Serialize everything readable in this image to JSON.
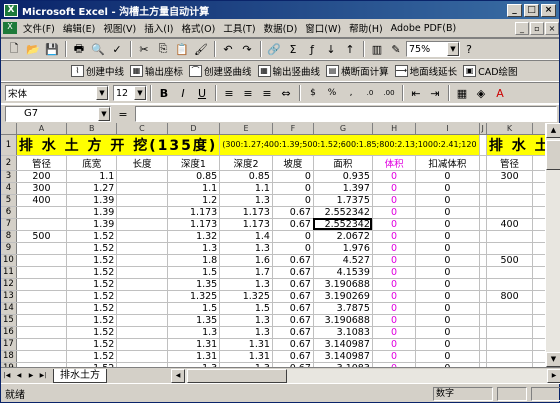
{
  "window": {
    "title": "Microsoft Excel - 沟槽土方量自动计算"
  },
  "menu": [
    "文件(F)",
    "编辑(E)",
    "视图(V)",
    "插入(I)",
    "格式(O)",
    "工具(T)",
    "数据(D)",
    "窗口(W)",
    "帮助(H)",
    "Adobe PDF(B)"
  ],
  "toolbar": {
    "zoom": "75%"
  },
  "toolbar2": [
    "创建中线",
    "输出座标",
    "创建竖曲线",
    "输出竖曲线",
    "横断面计算",
    "地面线延长",
    "CAD绘图"
  ],
  "font": {
    "name": "宋体",
    "size": "12"
  },
  "formula": {
    "namebox": "G7",
    "content": ""
  },
  "columns": [
    "A",
    "B",
    "C",
    "D",
    "E",
    "F",
    "G",
    "H",
    "I",
    "J",
    "K"
  ],
  "title_row": {
    "main": "排 水 土 方 开 挖(135度)",
    "params": "(300:1.27;400:1.39;500:1.52;600:1.85;800:2.13;1000:2.41;120",
    "right": "排 水 土"
  },
  "headers": [
    "管径",
    "底宽",
    "长度",
    "深度1",
    "深度2",
    "坡度",
    "面积",
    "体积",
    "扣减体积",
    "",
    "管径"
  ],
  "rows": [
    {
      "r": "3",
      "a": "200",
      "b": "1.1",
      "d": "0.85",
      "e": "0.85",
      "f": "0",
      "g": "0.935",
      "h": "0",
      "i": "0",
      "k": "300"
    },
    {
      "r": "4",
      "a": "300",
      "b": "1.27",
      "d": "1.1",
      "e": "1.1",
      "f": "0",
      "g": "1.397",
      "h": "0",
      "i": "0",
      "k": ""
    },
    {
      "r": "5",
      "a": "400",
      "b": "1.39",
      "d": "1.2",
      "e": "1.3",
      "f": "0",
      "g": "1.7375",
      "h": "0",
      "i": "0",
      "k": ""
    },
    {
      "r": "6",
      "a": "",
      "b": "1.39",
      "d": "1.173",
      "e": "1.173",
      "f": "0.67",
      "g": "2.552342",
      "h": "0",
      "i": "0",
      "k": ""
    },
    {
      "r": "7",
      "a": "",
      "b": "1.39",
      "d": "1.173",
      "e": "1.173",
      "f": "0.67",
      "g": "2.552342",
      "h": "0",
      "i": "0",
      "k": "400"
    },
    {
      "r": "8",
      "a": "500",
      "b": "1.52",
      "d": "1.32",
      "e": "1.4",
      "f": "0",
      "g": "2.0672",
      "h": "0",
      "i": "0",
      "k": ""
    },
    {
      "r": "9",
      "a": "",
      "b": "1.52",
      "d": "1.3",
      "e": "1.3",
      "f": "0",
      "g": "1.976",
      "h": "0",
      "i": "0",
      "k": ""
    },
    {
      "r": "10",
      "a": "",
      "b": "1.52",
      "d": "1.8",
      "e": "1.6",
      "f": "0.67",
      "g": "4.527",
      "h": "0",
      "i": "0",
      "k": "500"
    },
    {
      "r": "11",
      "a": "",
      "b": "1.52",
      "d": "1.5",
      "e": "1.7",
      "f": "0.67",
      "g": "4.1539",
      "h": "0",
      "i": "0",
      "k": ""
    },
    {
      "r": "12",
      "a": "",
      "b": "1.52",
      "d": "1.35",
      "e": "1.3",
      "f": "0.67",
      "g": "3.190688",
      "h": "0",
      "i": "0",
      "k": ""
    },
    {
      "r": "13",
      "a": "",
      "b": "1.52",
      "d": "1.325",
      "e": "1.325",
      "f": "0.67",
      "g": "3.190269",
      "h": "0",
      "i": "0",
      "k": "800"
    },
    {
      "r": "14",
      "a": "",
      "b": "1.52",
      "d": "1.5",
      "e": "1.5",
      "f": "0.67",
      "g": "3.7875",
      "h": "0",
      "i": "0",
      "k": ""
    },
    {
      "r": "15",
      "a": "",
      "b": "1.52",
      "d": "1.35",
      "e": "1.3",
      "f": "0.67",
      "g": "3.190688",
      "h": "0",
      "i": "0",
      "k": ""
    },
    {
      "r": "16",
      "a": "",
      "b": "1.52",
      "d": "1.3",
      "e": "1.3",
      "f": "0.67",
      "g": "3.1083",
      "h": "0",
      "i": "0",
      "k": ""
    },
    {
      "r": "17",
      "a": "",
      "b": "1.52",
      "d": "1.31",
      "e": "1.31",
      "f": "0.67",
      "g": "3.140987",
      "h": "0",
      "i": "0",
      "k": ""
    },
    {
      "r": "18",
      "a": "",
      "b": "1.52",
      "d": "1.31",
      "e": "1.31",
      "f": "0.67",
      "g": "3.140987",
      "h": "0",
      "i": "0",
      "k": ""
    },
    {
      "r": "19",
      "a": "",
      "b": "1.52",
      "d": "1.3",
      "e": "1.3",
      "f": "0.67",
      "g": "3.1083",
      "h": "0",
      "i": "0",
      "k": ""
    }
  ],
  "sheet_tab": "排水土方",
  "status": {
    "left": "就绪",
    "right": "数字"
  },
  "colors": {
    "title_bg": "#ffff00",
    "volume_text": "#e000e0",
    "titlebar": "#0a246a"
  }
}
